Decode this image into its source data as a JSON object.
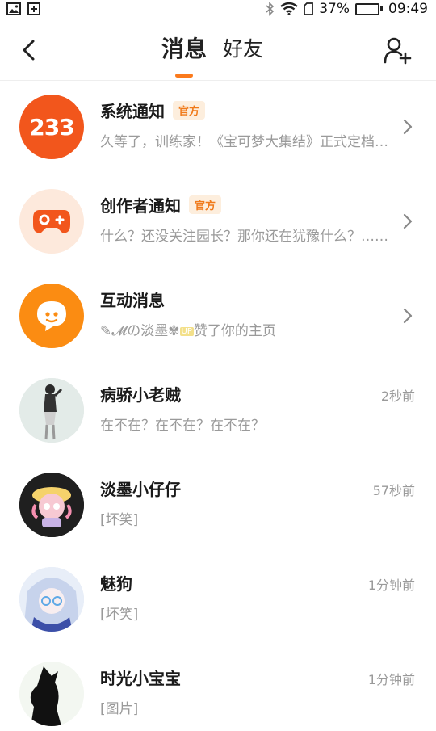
{
  "status_bar": {
    "battery_percent": "37%",
    "time": "09:49",
    "battery_level": 1.0
  },
  "header": {
    "tabs": [
      {
        "label": "消息",
        "active": true
      },
      {
        "label": "好友",
        "active": false
      }
    ]
  },
  "colors": {
    "accent": "#fb7a1c",
    "badge_bg": "#fdeedd",
    "badge_text": "#f07a1a",
    "secondary_text": "#9a9a9a"
  },
  "messages": [
    {
      "name": "系统通知",
      "badge": "官方",
      "preview": "久等了，训练家！《宝可梦大集结》正式定档……",
      "avatar_text": "233",
      "avatar_icon": "bilibili-233-logo"
    },
    {
      "name": "创作者通知",
      "badge": "官方",
      "preview": "什么？还没关注园长？那你还在犹豫什么？……",
      "avatar_icon": "gamepad-icon"
    },
    {
      "name": "互动消息",
      "preview_parts": {
        "sender": "✎𝓜の淡墨✾",
        "up_tag": "UP",
        "action": "赞了你的主页"
      },
      "avatar_icon": "chat-bubble-icon"
    },
    {
      "name": "病骄小老贼",
      "preview": "在不在？在不在？在不在？",
      "time": "2秒前"
    },
    {
      "name": "淡墨小仔仔",
      "preview": "[坏笑]",
      "time": "57秒前"
    },
    {
      "name": "魅狗",
      "preview": "[坏笑]",
      "time": "1分钟前"
    },
    {
      "name": "时光小宝宝",
      "preview": "[图片]",
      "time": "1分钟前"
    }
  ]
}
